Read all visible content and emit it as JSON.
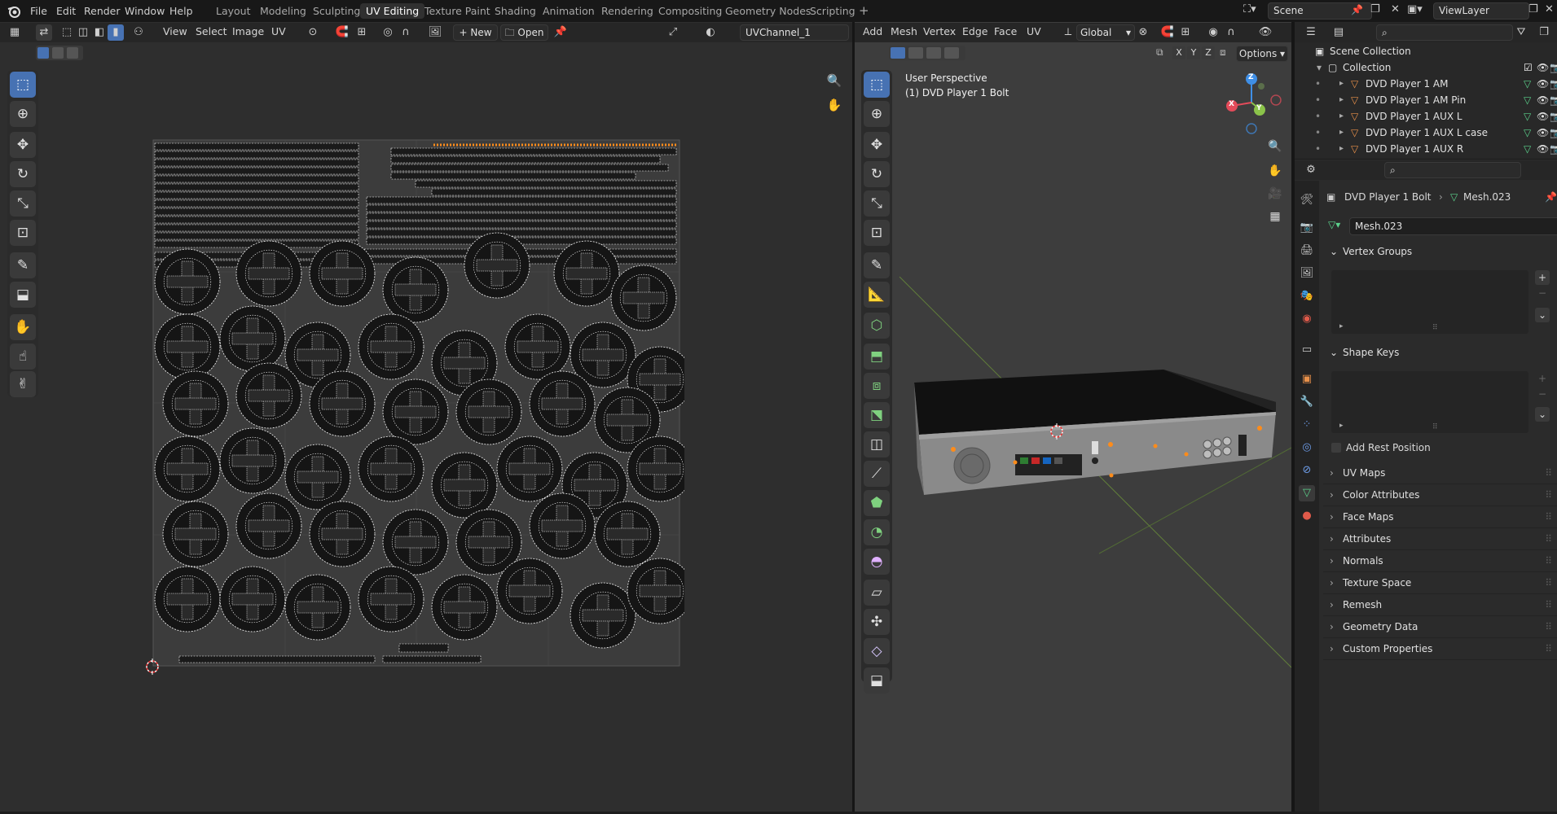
{
  "topbar": {
    "menus": [
      "File",
      "Edit",
      "Render",
      "Window",
      "Help"
    ],
    "workspaces": [
      {
        "label": "Layout",
        "active": false
      },
      {
        "label": "Modeling",
        "active": false
      },
      {
        "label": "Sculpting",
        "active": false
      },
      {
        "label": "UV Editing",
        "active": true
      },
      {
        "label": "Texture Paint",
        "active": false
      },
      {
        "label": "Shading",
        "active": false
      },
      {
        "label": "Animation",
        "active": false
      },
      {
        "label": "Rendering",
        "active": false
      },
      {
        "label": "Compositing",
        "active": false
      },
      {
        "label": "Geometry Nodes",
        "active": false
      },
      {
        "label": "Scripting",
        "active": false
      }
    ],
    "add_workspace_symbol": "+",
    "scene_value": "Scene",
    "view_layer_value": "ViewLayer"
  },
  "uv_editor": {
    "menus": [
      "View",
      "Select",
      "Image",
      "UV"
    ],
    "new_label": "New",
    "open_label": "Open",
    "uv_map_value": "UVChannel_1"
  },
  "viewport": {
    "menus": [
      "Add",
      "Mesh",
      "Vertex",
      "Edge",
      "Face",
      "UV"
    ],
    "orientation_value": "Global",
    "axes_labels": [
      "X",
      "Y",
      "Z"
    ],
    "options_label": "Options",
    "overlay_line1": "User Perspective",
    "overlay_line2": "(1) DVD Player 1 Bolt",
    "gizmo_axes": {
      "x": "X",
      "y": "Y",
      "z": "Z"
    }
  },
  "outliner": {
    "scene_collection_label": "Scene Collection",
    "collection_label": "Collection",
    "items": [
      {
        "label": "DVD Player 1 AM"
      },
      {
        "label": "DVD Player 1 AM Pin"
      },
      {
        "label": "DVD Player 1 AUX L"
      },
      {
        "label": "DVD Player 1 AUX L case"
      },
      {
        "label": "DVD Player 1 AUX R"
      }
    ]
  },
  "properties": {
    "object_name": "DVD Player 1 Bolt",
    "mesh_name": "Mesh.023",
    "mesh_field_value": "Mesh.023",
    "vertex_groups_label": "Vertex Groups",
    "shape_keys_label": "Shape Keys",
    "add_rest_position_label": "Add Rest Position",
    "collapsed_panels": [
      "UV Maps",
      "Color Attributes",
      "Face Maps",
      "Attributes",
      "Normals",
      "Texture Space",
      "Remesh",
      "Geometry Data",
      "Custom Properties"
    ]
  },
  "colors": {
    "accent_blue": "#4772b3",
    "uv_island_stroke": "#ffffff",
    "selected_edge_orange": "#ff8c1a",
    "axis_x": "#e44b5a",
    "axis_y": "#8bc34a",
    "axis_z": "#3f8fe6",
    "mesh_data_green": "#5bd18b",
    "object_orange": "#e8904a"
  }
}
